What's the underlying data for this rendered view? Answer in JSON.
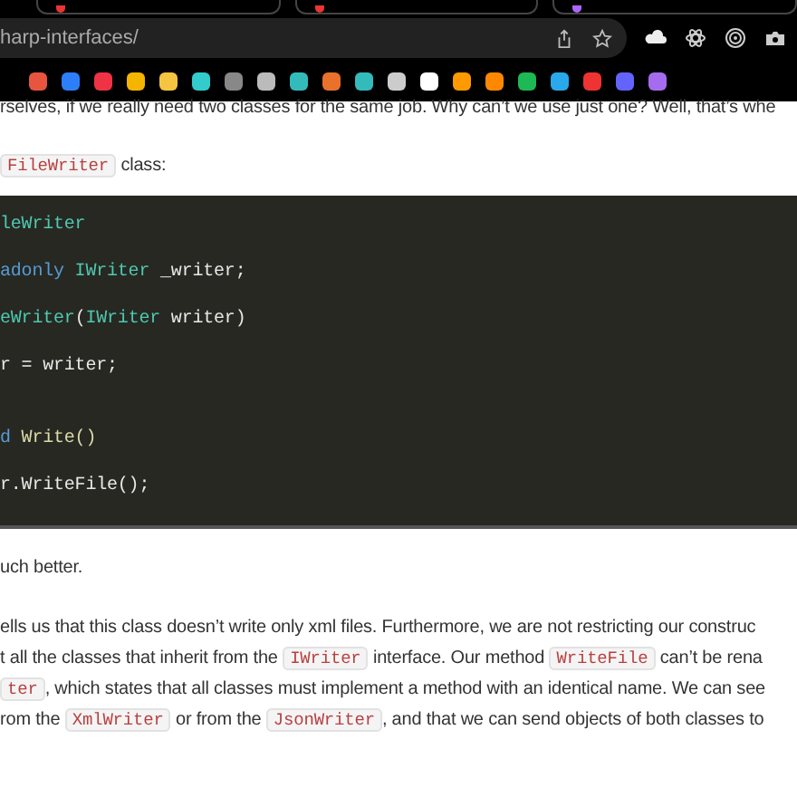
{
  "browser": {
    "url": "harp-interfaces/"
  },
  "article": {
    "top_line": "rselves, if we really need two classes for the same job. Why can’t we use just one? Well, that’s whe",
    "intro": [
      {
        "text": "FileWriter",
        "code": true
      },
      {
        "text": " class:",
        "code": false
      }
    ],
    "code_block": {
      "lines": [
        {
          "blank_before": false,
          "tokens": [
            {
              "text": "leWriter",
              "kind": "type"
            }
          ]
        },
        {
          "blank_before": false,
          "tokens": [
            {
              "text": "adonly",
              "kind": "keyword"
            },
            {
              "text": " IWriter",
              "kind": "type"
            },
            {
              "text": " _writer;",
              "kind": "plain"
            }
          ]
        },
        {
          "blank_before": false,
          "tokens": [
            {
              "text": "eWriter",
              "kind": "type"
            },
            {
              "text": "(",
              "kind": "plain"
            },
            {
              "text": "IWriter",
              "kind": "type"
            },
            {
              "text": " writer)",
              "kind": "plain"
            }
          ]
        },
        {
          "blank_before": false,
          "tokens": [
            {
              "text": "r = writer;",
              "kind": "plain"
            }
          ]
        },
        {
          "blank_before": true,
          "tokens": [
            {
              "text": "d",
              "kind": "keyword"
            },
            {
              "text": " Write()",
              "kind": "method"
            }
          ]
        },
        {
          "blank_before": false,
          "tokens": [
            {
              "text": "r.WriteFile();",
              "kind": "plain"
            }
          ]
        }
      ]
    },
    "short_para": "uch better.",
    "para_lines": [
      [
        {
          "text": "ells us that this class doesn’t write only xml files. Furthermore, we are not restricting our construc",
          "code": false
        }
      ],
      [
        {
          "text": "t all the classes that inherit from the ",
          "code": false
        },
        {
          "text": "IWriter",
          "code": true
        },
        {
          "text": " interface. Our method ",
          "code": false
        },
        {
          "text": "WriteFile",
          "code": true
        },
        {
          "text": " can’t be rena",
          "code": false
        }
      ],
      [
        {
          "text": "ter",
          "code": true
        },
        {
          "text": ", which states that all classes must implement a method with an identical name. We can see",
          "code": false
        }
      ],
      [
        {
          "text": "rom the ",
          "code": false
        },
        {
          "text": "XmlWriter",
          "code": true
        },
        {
          "text": " or from the ",
          "code": false
        },
        {
          "text": "JsonWriter",
          "code": true
        },
        {
          "text": ", and that we can send objects of both classes to",
          "code": false
        }
      ]
    ]
  }
}
